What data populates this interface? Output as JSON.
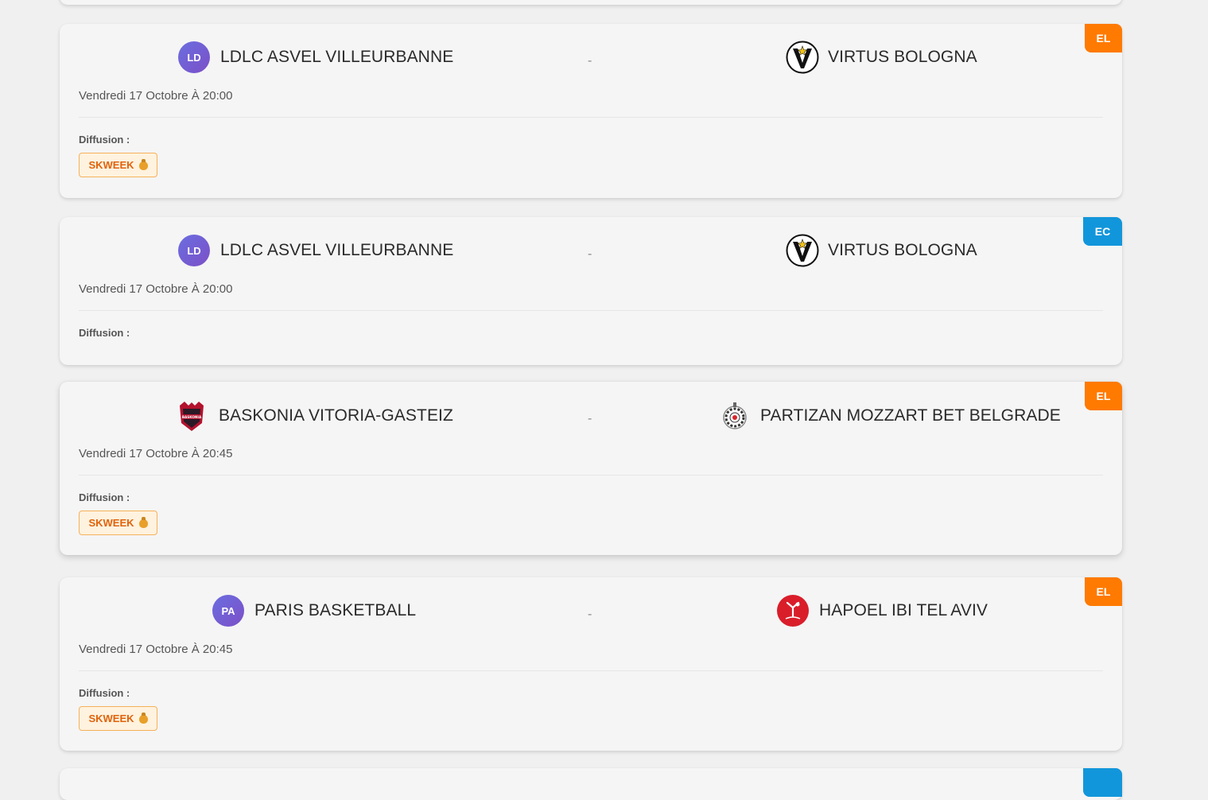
{
  "colors": {
    "EL": "#ff7a00",
    "EC": "#1296db"
  },
  "labels": {
    "separator": "-",
    "diffusion": "Diffusion :"
  },
  "matches": [
    {
      "competition": "EL",
      "home": {
        "name": "LDLC ASVEL VILLEURBANNE",
        "avatar": "LD"
      },
      "away": {
        "name": "VIRTUS BOLOGNA",
        "logo": "virtus-bologna-logo"
      },
      "datetime": "Vendredi 17 Octobre À 20:00",
      "broadcasts": [
        "SKWEEK"
      ]
    },
    {
      "competition": "EC",
      "home": {
        "name": "LDLC ASVEL VILLEURBANNE",
        "avatar": "LD"
      },
      "away": {
        "name": "VIRTUS BOLOGNA",
        "logo": "virtus-bologna-logo"
      },
      "datetime": "Vendredi 17 Octobre À 20:00",
      "broadcasts": []
    },
    {
      "competition": "EL",
      "home": {
        "name": "BASKONIA VITORIA-GASTEIZ",
        "logo": "baskonia-logo"
      },
      "away": {
        "name": "PARTIZAN MOZZART BET BELGRADE",
        "logo": "partizan-logo"
      },
      "datetime": "Vendredi 17 Octobre À 20:45",
      "broadcasts": [
        "SKWEEK"
      ]
    },
    {
      "competition": "EL",
      "home": {
        "name": "PARIS BASKETBALL",
        "avatar": "PA"
      },
      "away": {
        "name": "HAPOEL IBI TEL AVIV",
        "logo": "hapoel-logo"
      },
      "datetime": "Vendredi 17 Octobre À 20:45",
      "broadcasts": [
        "SKWEEK"
      ]
    }
  ]
}
